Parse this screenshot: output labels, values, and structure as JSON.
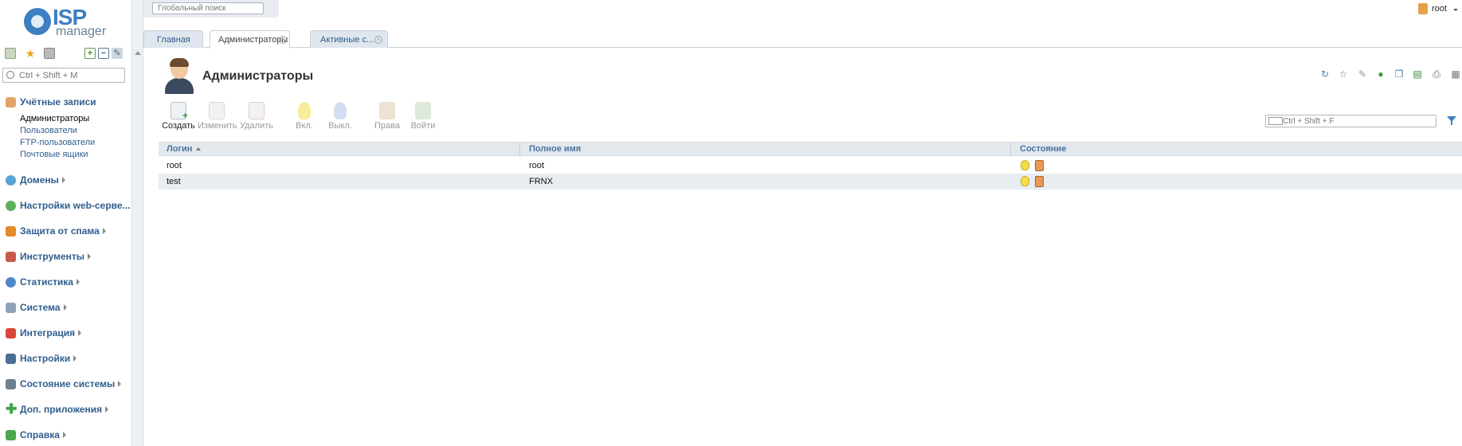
{
  "logo": {
    "brand": "ISP",
    "product": "manager"
  },
  "search": {
    "global_placeholder": "Глобальный поиск",
    "menu_placeholder": "Ctrl + Shift + M",
    "filter_placeholder": "Ctrl + Shift + F"
  },
  "user": {
    "name": "root"
  },
  "sidebar": {
    "groups": [
      {
        "label": "Учётные записи",
        "icon": "users-icon",
        "expanded": true,
        "items": [
          "Администраторы",
          "Пользователи",
          "FTP-пользователи",
          "Почтовые ящики"
        ]
      },
      {
        "label": "Домены",
        "icon": "globe-icon"
      },
      {
        "label": "Настройки web-серве...",
        "icon": "web-settings-icon"
      },
      {
        "label": "Защита от спама",
        "icon": "shield-icon"
      },
      {
        "label": "Инструменты",
        "icon": "tools-icon"
      },
      {
        "label": "Статистика",
        "icon": "stats-icon"
      },
      {
        "label": "Система",
        "icon": "system-icon"
      },
      {
        "label": "Интеграция",
        "icon": "integration-icon"
      },
      {
        "label": "Настройки",
        "icon": "settings-icon"
      },
      {
        "label": "Состояние системы",
        "icon": "monitor-icon"
      },
      {
        "label": "Доп. приложения",
        "icon": "plus-icon"
      },
      {
        "label": "Справка",
        "icon": "help-icon"
      }
    ]
  },
  "tabs": [
    {
      "label": "Главная",
      "active": false
    },
    {
      "label": "Администраторы",
      "active": true,
      "close": "×"
    },
    {
      "label": "Активные с...",
      "active": false,
      "close": "×"
    }
  ],
  "page": {
    "title": "Администраторы"
  },
  "toolbar": {
    "create": "Создать",
    "edit": "Изменить",
    "delete": "Удалить",
    "on": "Вкл.",
    "off": "Выкл.",
    "rights": "Права",
    "login": "Войти"
  },
  "table": {
    "columns": [
      "Логин",
      "Полное имя",
      "Состояние"
    ],
    "rows": [
      {
        "login": "root",
        "fullname": "root"
      },
      {
        "login": "test",
        "fullname": "FRNX"
      }
    ]
  },
  "colors": {
    "accent": "#3d7fc1",
    "link": "#2f5e8e",
    "header_bg": "#e3e8ed",
    "row_alt": "#e8edf2"
  }
}
